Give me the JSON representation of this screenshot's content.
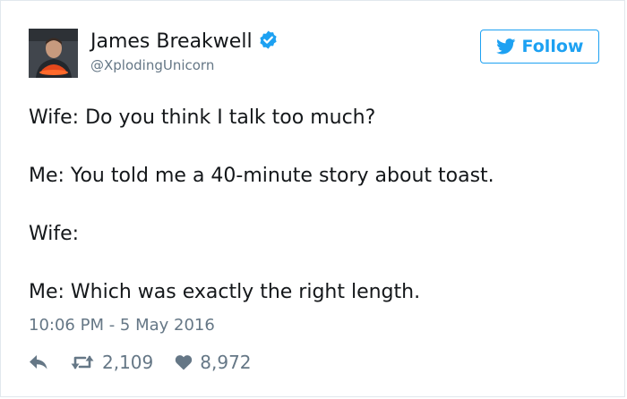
{
  "author": {
    "name": "James Breakwell",
    "handle": "@XplodingUnicorn",
    "verified": true
  },
  "follow_button": {
    "label": "Follow"
  },
  "tweet": {
    "lines": [
      "Wife: Do you think I talk too much?",
      "Me: You told me a 40-minute story about toast.",
      "Wife:",
      "Me: Which was exactly the right length."
    ],
    "timestamp": "10:06 PM - 5 May 2016"
  },
  "stats": {
    "retweets": "2,109",
    "likes": "8,972"
  },
  "icons": {
    "follow": "twitter-bird-icon",
    "verified": "verified-badge-icon",
    "reply": "reply-icon",
    "retweet": "retweet-icon",
    "like": "heart-icon"
  },
  "colors": {
    "accent": "#1da1f2",
    "text": "#14171a",
    "muted": "#657786",
    "border": "#e1e8ed"
  }
}
